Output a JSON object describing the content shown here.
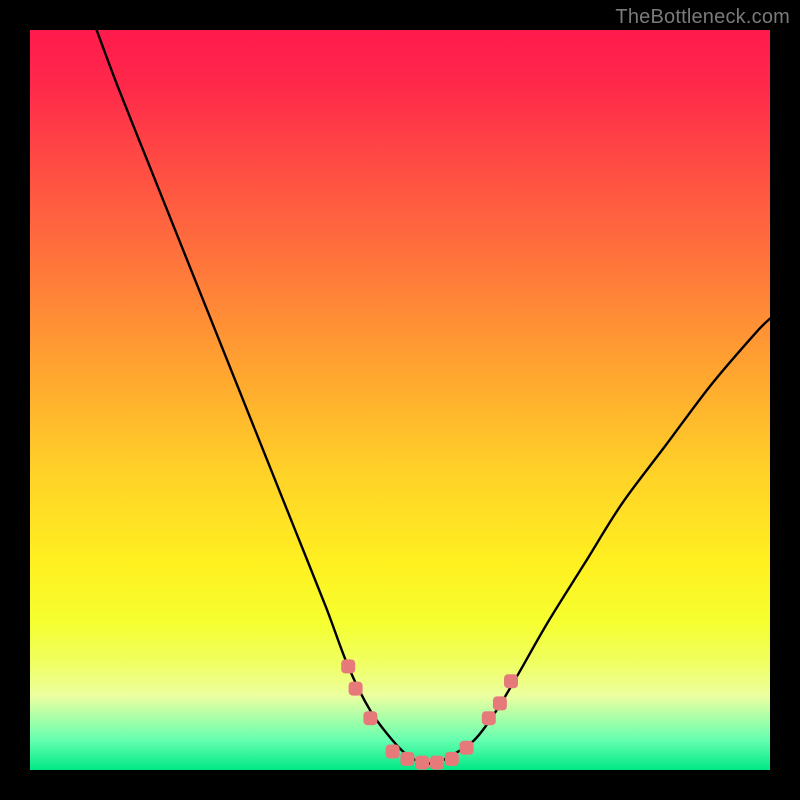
{
  "watermark": "TheBottleneck.com",
  "chart_data": {
    "type": "line",
    "title": "",
    "xlabel": "",
    "ylabel": "",
    "xlim": [
      0,
      100
    ],
    "ylim": [
      0,
      100
    ],
    "series": [
      {
        "name": "bottleneck-curve",
        "x": [
          9,
          12,
          16,
          20,
          24,
          28,
          32,
          36,
          40,
          43,
          46,
          49,
          51,
          53,
          55,
          57,
          60,
          63,
          66,
          70,
          75,
          80,
          86,
          92,
          98,
          100
        ],
        "y": [
          100,
          92,
          82,
          72,
          62,
          52,
          42,
          32,
          22,
          14,
          8,
          4,
          2,
          1,
          1,
          2,
          4,
          8,
          13,
          20,
          28,
          36,
          44,
          52,
          59,
          61
        ]
      }
    ],
    "markers": {
      "name": "highlight-dots",
      "color": "#e67a7a",
      "points": [
        {
          "x": 43,
          "y": 14
        },
        {
          "x": 44,
          "y": 11
        },
        {
          "x": 46,
          "y": 7
        },
        {
          "x": 49,
          "y": 2.5
        },
        {
          "x": 51,
          "y": 1.5
        },
        {
          "x": 53,
          "y": 1
        },
        {
          "x": 55,
          "y": 1
        },
        {
          "x": 57,
          "y": 1.5
        },
        {
          "x": 59,
          "y": 3
        },
        {
          "x": 62,
          "y": 7
        },
        {
          "x": 63.5,
          "y": 9
        },
        {
          "x": 65,
          "y": 12
        }
      ]
    }
  }
}
